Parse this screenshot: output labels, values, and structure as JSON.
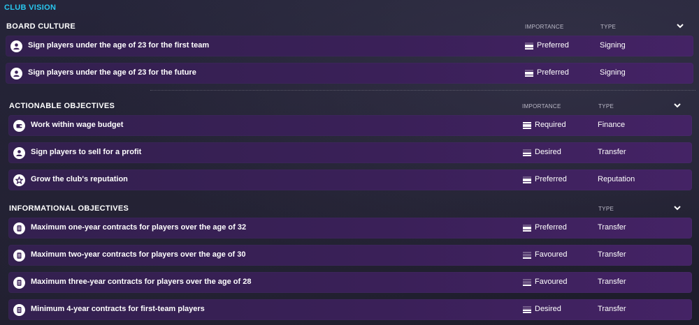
{
  "page": {
    "title": "CLUB VISION"
  },
  "colors": {
    "accent": "#28c8f0",
    "row_bg": "#3a2058",
    "background": "#1e1d2b"
  },
  "board_culture": {
    "title": "BOARD CULTURE",
    "importance_header": "IMPORTANCE",
    "type_header": "TYPE",
    "rows": [
      {
        "icon": "person-icon",
        "text": "Sign players under the age of 23 for the first team",
        "importance": "Preferred",
        "importance_level": 3,
        "type": "Signing"
      },
      {
        "icon": "person-icon",
        "text": "Sign players under the age of 23 for the future",
        "importance": "Preferred",
        "importance_level": 3,
        "type": "Signing"
      }
    ]
  },
  "actionable": {
    "title": "ACTIONABLE OBJECTIVES",
    "importance_header": "IMPORTANCE",
    "type_header": "TYPE",
    "rows": [
      {
        "icon": "wallet-icon",
        "text": "Work within wage budget",
        "importance": "Required",
        "importance_level": 4,
        "type": "Finance"
      },
      {
        "icon": "person-icon",
        "text": "Sign players to sell for a profit",
        "importance": "Desired",
        "importance_level": 2,
        "type": "Transfer"
      },
      {
        "icon": "star-icon",
        "text": "Grow the club's reputation",
        "importance": "Preferred",
        "importance_level": 3,
        "type": "Reputation"
      }
    ]
  },
  "informational": {
    "title": "INFORMATIONAL OBJECTIVES",
    "type_header": "TYPE",
    "rows": [
      {
        "icon": "document-icon",
        "text": "Maximum one-year contracts for players over the age of 32",
        "importance": "Preferred",
        "importance_level": 3,
        "type": "Transfer"
      },
      {
        "icon": "document-icon",
        "text": "Maximum two-year contracts for players over the age of 30",
        "importance": "Favoured",
        "importance_level": 1,
        "type": "Transfer"
      },
      {
        "icon": "document-icon",
        "text": "Maximum three-year contracts for players over the age of 28",
        "importance": "Favoured",
        "importance_level": 1,
        "type": "Transfer"
      },
      {
        "icon": "document-icon",
        "text": "Minimum 4-year contracts for first-team players",
        "importance": "Desired",
        "importance_level": 2,
        "type": "Transfer"
      }
    ]
  }
}
